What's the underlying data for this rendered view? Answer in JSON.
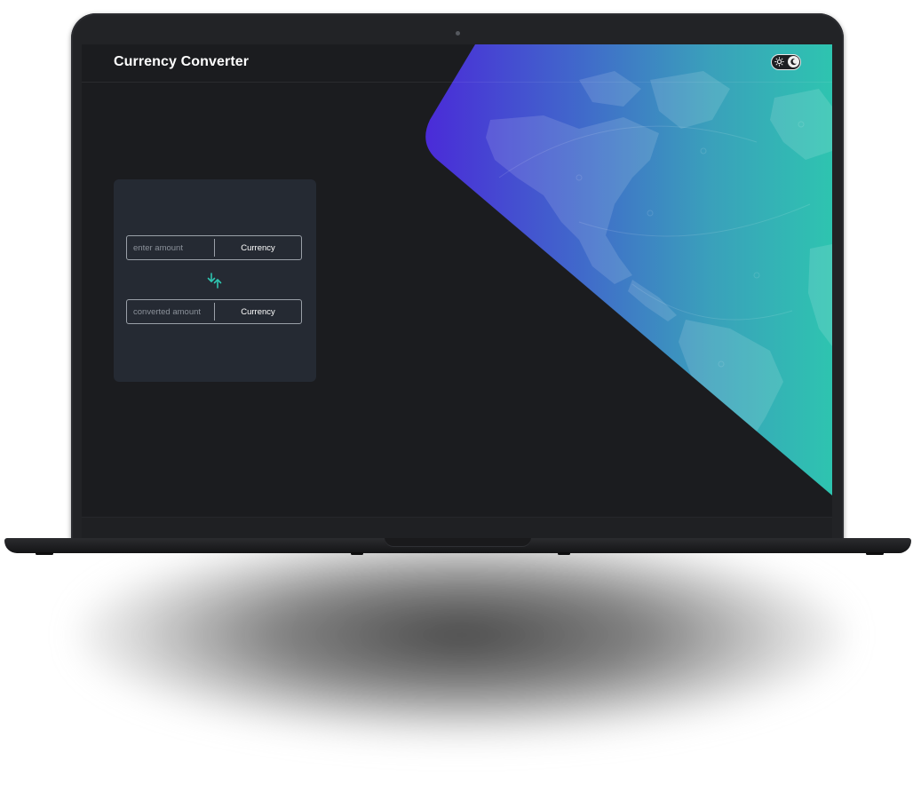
{
  "app": {
    "title": "Currency Converter"
  },
  "theme_toggle": {
    "icons": [
      "sun-icon",
      "moon-icon"
    ],
    "state": "dark"
  },
  "converter": {
    "from": {
      "amount_placeholder": "enter amount",
      "amount_value": "",
      "currency_label": "Currency"
    },
    "swap_icon": "swap-arrows-icon",
    "to": {
      "amount_placeholder": "converted amount",
      "amount_value": "",
      "currency_label": "Currency"
    }
  },
  "colors": {
    "background": "#1b1c1f",
    "card": "#252a33",
    "accent": "#2ec4b0",
    "gradient_start": "#4a2fd6",
    "gradient_end": "#2ec4b0",
    "text": "#ffffff"
  }
}
